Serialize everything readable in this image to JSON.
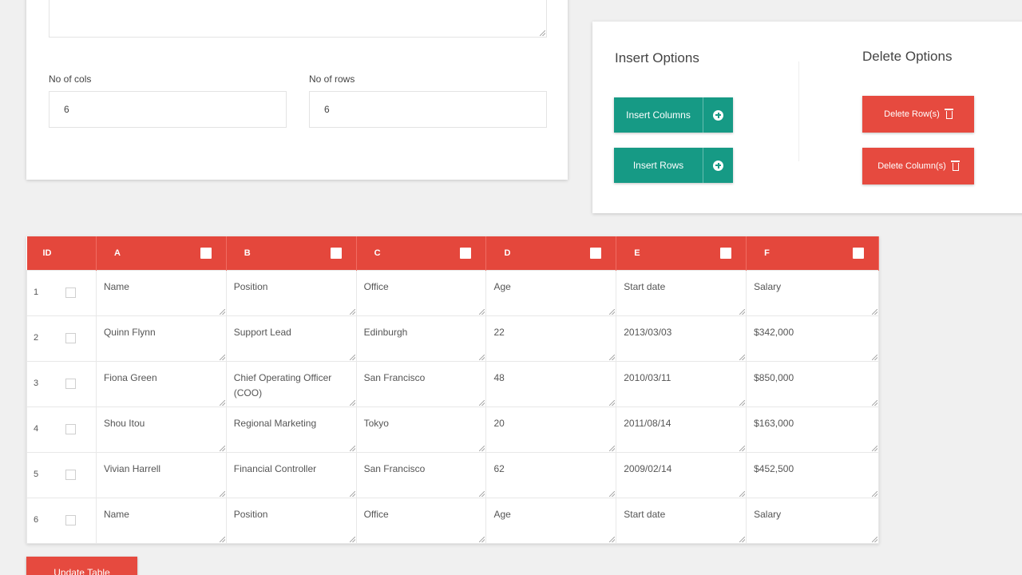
{
  "form": {
    "cols_label": "No of cols",
    "cols_value": "6",
    "rows_label": "No of rows",
    "rows_value": "6"
  },
  "insert": {
    "title": "Insert Options",
    "insert_columns_label": "Insert Columns",
    "insert_rows_label": "Insert Rows",
    "icon": "plus-circle-icon"
  },
  "delete": {
    "title": "Delete Options",
    "delete_rows_label": "Delete Row(s)",
    "delete_columns_label": "Delete Column(s)",
    "icon": "trash-icon"
  },
  "table": {
    "id_header": "ID",
    "columns": [
      "A",
      "B",
      "C",
      "D",
      "E",
      "F"
    ],
    "rows": [
      {
        "id": "1",
        "cells": [
          "Name",
          "Position",
          "Office",
          "Age",
          "Start date",
          "Salary"
        ]
      },
      {
        "id": "2",
        "cells": [
          "Quinn Flynn",
          "Support Lead",
          "Edinburgh",
          "22",
          "2013/03/03",
          "$342,000"
        ]
      },
      {
        "id": "3",
        "cells": [
          "Fiona Green",
          "Chief Operating Officer (COO)",
          "San Francisco",
          "48",
          "2010/03/11",
          "$850,000"
        ]
      },
      {
        "id": "4",
        "cells": [
          "Shou Itou",
          "Regional Marketing",
          "Tokyo",
          "20",
          "2011/08/14",
          "$163,000"
        ]
      },
      {
        "id": "5",
        "cells": [
          "Vivian Harrell",
          "Financial Controller",
          "San Francisco",
          "62",
          "2009/02/14",
          "$452,500"
        ]
      },
      {
        "id": "6",
        "cells": [
          "Name",
          "Position",
          "Office",
          "Age",
          "Start date",
          "Salary"
        ]
      }
    ]
  },
  "update_label": "Update Table",
  "colors": {
    "accent_red": "#e4473c",
    "accent_green": "#169a85",
    "background": "#f0f0f0"
  }
}
